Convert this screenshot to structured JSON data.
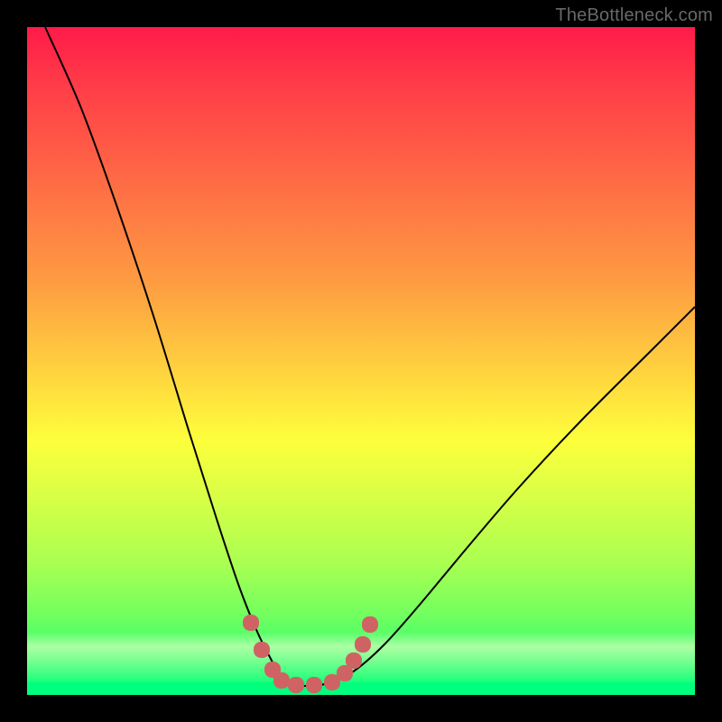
{
  "watermark": "TheBottleneck.com",
  "chart_data": {
    "type": "line",
    "title": "",
    "xlabel": "",
    "ylabel": "",
    "xrange": [
      0,
      740
    ],
    "ylim": [
      0,
      740
    ],
    "series": [
      {
        "name": "bottleneck-curve",
        "color": "#000000",
        "width": 2,
        "x": [
          20,
          60,
          100,
          140,
          180,
          210,
          235,
          255,
          270,
          280,
          290,
          305,
          330,
          360,
          395,
          435,
          485,
          545,
          615,
          695,
          740
        ],
        "y": [
          740,
          650,
          540,
          420,
          290,
          195,
          120,
          70,
          40,
          22,
          12,
          10,
          12,
          25,
          55,
          100,
          160,
          230,
          305,
          385,
          430
        ]
      },
      {
        "name": "valley-markers",
        "color": "#cf6363",
        "marker_size": 9,
        "x": [
          248,
          260,
          272,
          282,
          298,
          318,
          338,
          352,
          362,
          372,
          380
        ],
        "y": [
          80,
          50,
          28,
          16,
          11,
          11,
          14,
          24,
          38,
          56,
          78
        ]
      }
    ]
  }
}
